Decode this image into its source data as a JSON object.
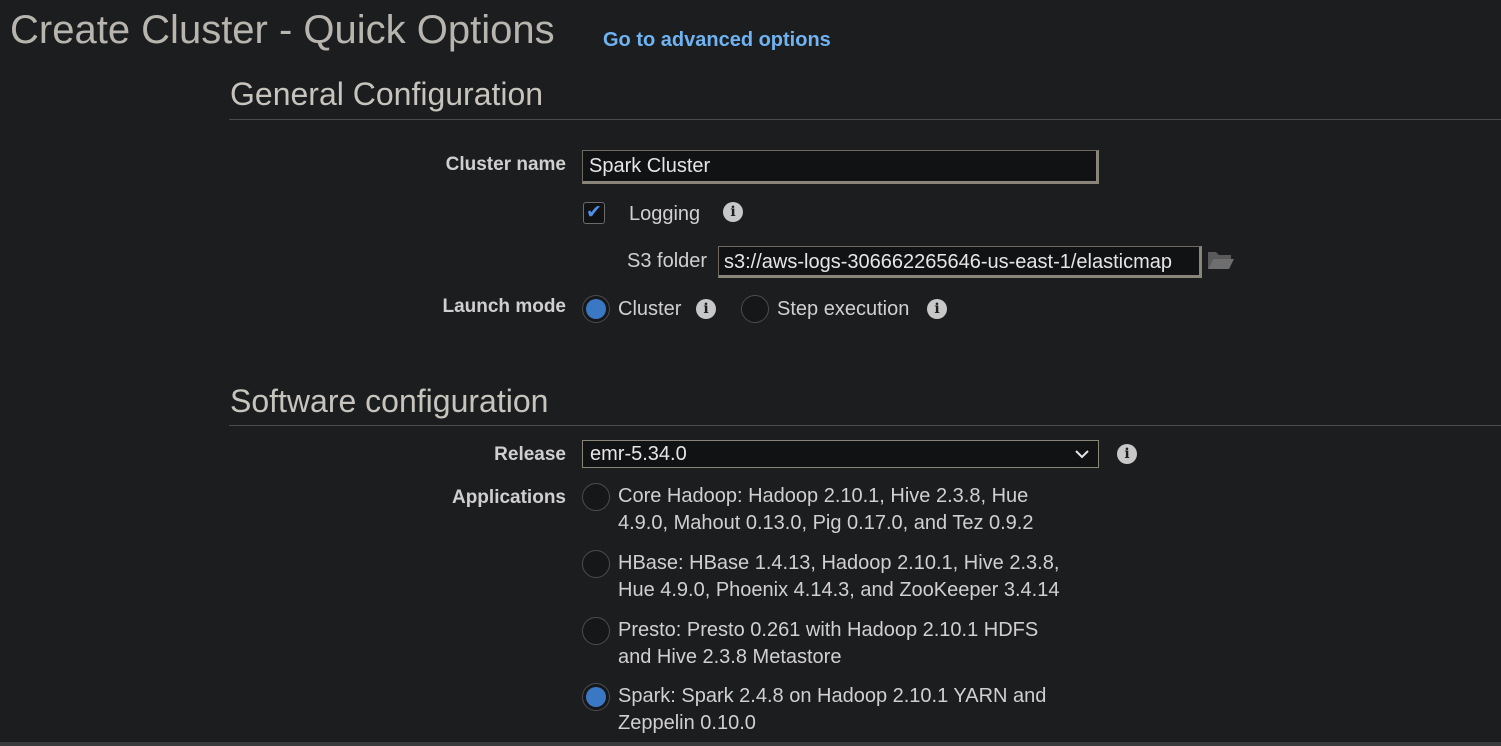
{
  "header": {
    "title": "Create Cluster - Quick Options",
    "advanced_link": "Go to advanced options"
  },
  "general": {
    "section_title": "General Configuration",
    "cluster_name_label": "Cluster name",
    "cluster_name_value": "Spark Cluster",
    "logging_label": "Logging",
    "logging_checked": true,
    "s3_folder_label": "S3 folder",
    "s3_folder_value": "s3://aws-logs-306662265646-us-east-1/elasticmap",
    "launch_mode_label": "Launch mode",
    "launch_modes": [
      {
        "label": "Cluster",
        "selected": true
      },
      {
        "label": "Step execution",
        "selected": false
      }
    ]
  },
  "software": {
    "section_title": "Software configuration",
    "release_label": "Release",
    "release_value": "emr-5.34.0",
    "applications_label": "Applications",
    "applications": [
      {
        "line1": "Core Hadoop: Hadoop 2.10.1, Hive 2.3.8, Hue",
        "line2": "4.9.0, Mahout 0.13.0, Pig 0.17.0, and Tez 0.9.2",
        "selected": false
      },
      {
        "line1": "HBase: HBase 1.4.13, Hadoop 2.10.1, Hive 2.3.8,",
        "line2": "Hue 4.9.0, Phoenix 4.14.3, and ZooKeeper 3.4.14",
        "selected": false
      },
      {
        "line1": "Presto: Presto 0.261 with Hadoop 2.10.1 HDFS",
        "line2": "and Hive 2.3.8 Metastore",
        "selected": false
      },
      {
        "line1": "Spark: Spark 2.4.8 on Hadoop 2.10.1 YARN and",
        "line2": "Zeppelin 0.10.0",
        "selected": true
      }
    ]
  },
  "icons": {
    "info": "info-icon",
    "folder": "folder-open-icon",
    "checkmark": "checkmark-icon",
    "chevron": "chevron-down-icon"
  },
  "colors": {
    "background": "#1c1d1f",
    "link": "#6fb3f2",
    "accent": "#3b78c4"
  }
}
